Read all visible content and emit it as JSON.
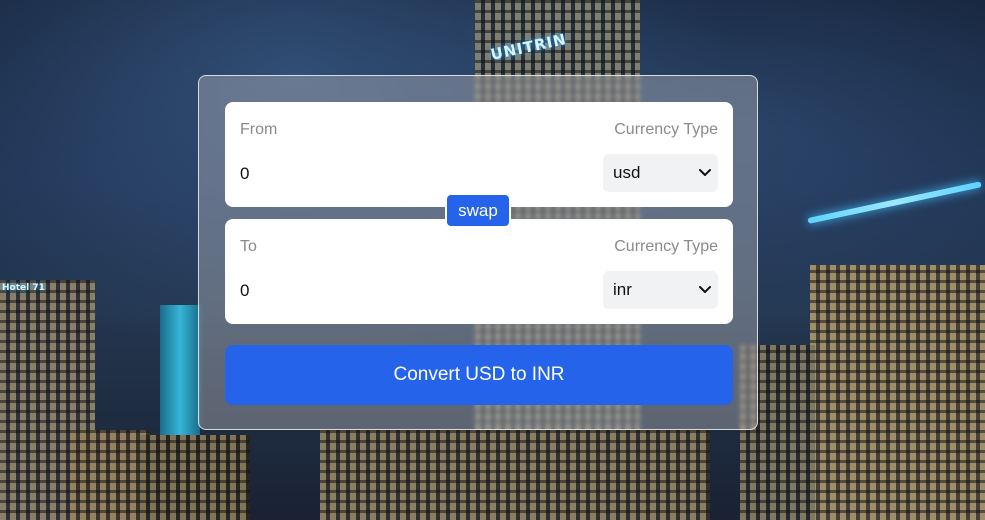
{
  "background": {
    "signs": [
      "UNITRIN",
      "Hotel 71"
    ]
  },
  "converter": {
    "from": {
      "label": "From",
      "currency_label": "Currency Type",
      "amount": "0",
      "currency": "usd"
    },
    "swap_label": "swap",
    "to": {
      "label": "To",
      "currency_label": "Currency Type",
      "amount": "0",
      "currency": "inr"
    },
    "convert_label": "Convert USD to INR"
  },
  "colors": {
    "accent": "#2563eb",
    "card": "#ffffff",
    "label": "#8a8a8a",
    "select_bg": "#f1f2f4"
  }
}
